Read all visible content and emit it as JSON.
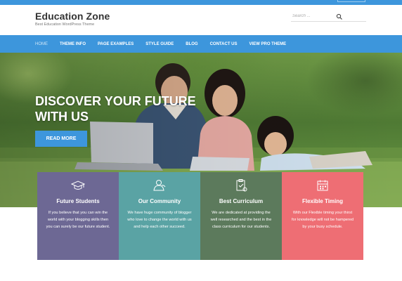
{
  "header": {
    "site_title": "Education Zone",
    "tagline": "Best Education WordPress Theme",
    "search_placeholder": "Search ..."
  },
  "nav": {
    "items": [
      {
        "label": "HOME",
        "active": true
      },
      {
        "label": "THEME INFO"
      },
      {
        "label": "PAGE EXAMPLES"
      },
      {
        "label": "STYLE GUIDE"
      },
      {
        "label": "BLOG"
      },
      {
        "label": "CONTACT US"
      },
      {
        "label": "VIEW PRO THEME"
      }
    ]
  },
  "hero": {
    "title": "DISCOVER YOUR FUTURE WITH US",
    "button": "READ MORE"
  },
  "features": [
    {
      "title": "Future Students",
      "text": "If you believe that you can win the world with your blogging skills then you can surely be our future student.",
      "color": "#6d6894",
      "icon": "graduation-cap-icon"
    },
    {
      "title": "Our Community",
      "text": "We have huge community of blogger who love to change the world with us and help each other succeed.",
      "color": "#5aa3a4",
      "icon": "community-icon"
    },
    {
      "title": "Best Curriculum",
      "text": "We are dedicated at providing the well researched and the best in the class curriculum for our students.",
      "color": "#5c7a5c",
      "icon": "curriculum-icon"
    },
    {
      "title": "Flexible Timing",
      "text": "With our Flexible timing your thirst for knowledge will not be hampered by your busy schedule.",
      "color": "#ee6e74",
      "icon": "calendar-icon"
    }
  ],
  "colors": {
    "accent": "#3d96dc"
  }
}
